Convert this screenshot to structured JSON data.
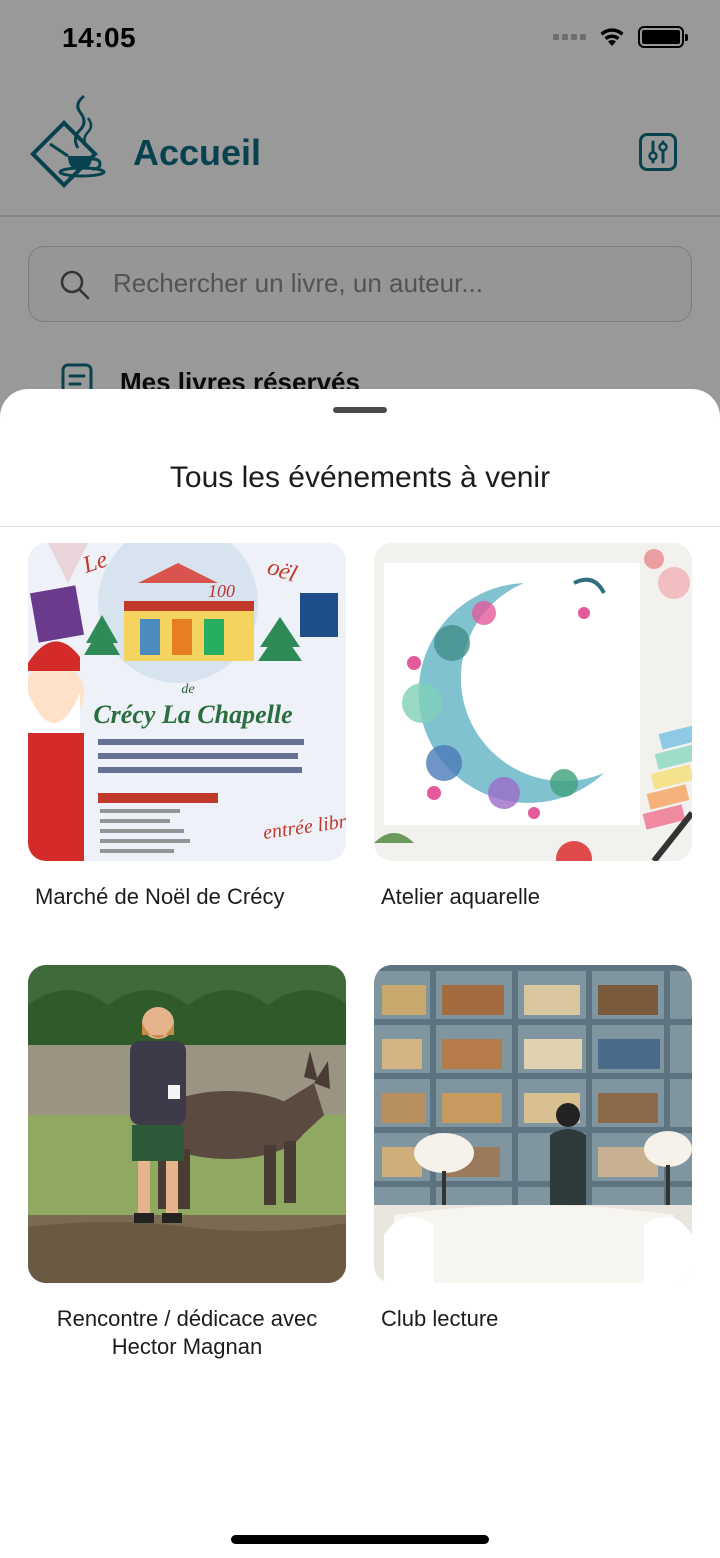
{
  "status_bar": {
    "time": "14:05"
  },
  "header": {
    "title": "Accueil"
  },
  "search": {
    "placeholder": "Rechercher un livre, un auteur..."
  },
  "reserved": {
    "label": "Mes livres réservés"
  },
  "sheet": {
    "title": "Tous les événements à venir",
    "events": [
      {
        "title": "Marché de Noël de Crécy",
        "poster": {
          "heading": "Le Marché de Noël",
          "town": "Crécy La Chapelle",
          "badge": "100",
          "entry": "entrée libre"
        }
      },
      {
        "title": "Atelier aquarelle"
      },
      {
        "title": "Rencontre / dédicace avec Hector Magnan"
      },
      {
        "title": "Club lecture"
      }
    ]
  },
  "colors": {
    "brand": "#0e6e84",
    "overlay": "rgba(0,0,0,0.40)"
  },
  "icons": [
    "wifi-icon",
    "battery-icon",
    "logo-icon",
    "filter-icon",
    "search-icon",
    "document-icon"
  ]
}
